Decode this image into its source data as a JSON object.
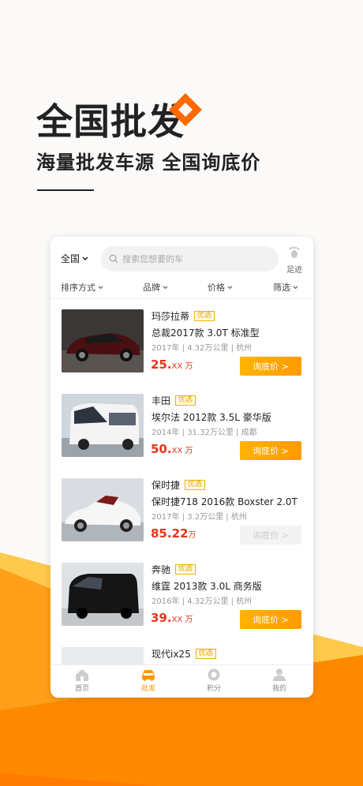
{
  "hero": {
    "title": "全国批发",
    "subtitle": "海量批发车源  全国询底价"
  },
  "colors": {
    "accent": "#ff9800",
    "price": "#e6341c",
    "badge": "#f0b400"
  },
  "topbar": {
    "region": "全国",
    "search_placeholder": "搜索您想要的车",
    "footprint_label": "足迹"
  },
  "filters": [
    "排序方式",
    "品牌",
    "价格",
    "筛选"
  ],
  "listings": [
    {
      "brand": "玛莎拉蒂",
      "badge": "优选",
      "model": "总裁2017款 3.0T 标准型",
      "year": "2017年",
      "mileage": "4.32万公里",
      "city": "杭州",
      "price": "25.",
      "price_tail": "XX 万",
      "button": "询底价 >",
      "enabled": true,
      "car_color": "maroon"
    },
    {
      "brand": "丰田",
      "badge": "优选",
      "model": "埃尔法 2012款 3.5L 豪华版",
      "year": "2014年",
      "mileage": "31.32万公里",
      "city": "成都",
      "price": "50.",
      "price_tail": "XX 万",
      "button": "询底价 >",
      "enabled": true,
      "car_color": "white"
    },
    {
      "brand": "保时捷",
      "badge": "优选",
      "model": "保时捷718 2016款 Boxster 2.0T",
      "year": "2017年",
      "mileage": "3.2万公里",
      "city": "杭州",
      "price": "85.22",
      "price_tail": "万",
      "button": "询底价 >",
      "enabled": false,
      "car_color": "white"
    },
    {
      "brand": "奔驰",
      "badge": "优选",
      "model": "维霆 2013款 3.0L 商务版",
      "year": "2016年",
      "mileage": "4.32万公里",
      "city": "杭州",
      "price": "39.",
      "price_tail": "XX 万",
      "button": "询底价 >",
      "enabled": true,
      "car_color": "black"
    },
    {
      "brand": "现代ix25",
      "badge": "优选",
      "model": "",
      "year": "",
      "mileage": "",
      "city": "",
      "price": "",
      "price_tail": "",
      "button": "",
      "enabled": true,
      "car_color": "white"
    }
  ],
  "tabs": [
    {
      "label": "首页",
      "icon": "home-icon",
      "active": false
    },
    {
      "label": "批发",
      "icon": "car-icon",
      "active": true
    },
    {
      "label": "积分",
      "icon": "points-icon",
      "active": false
    },
    {
      "label": "我的",
      "icon": "user-icon",
      "active": false
    }
  ]
}
